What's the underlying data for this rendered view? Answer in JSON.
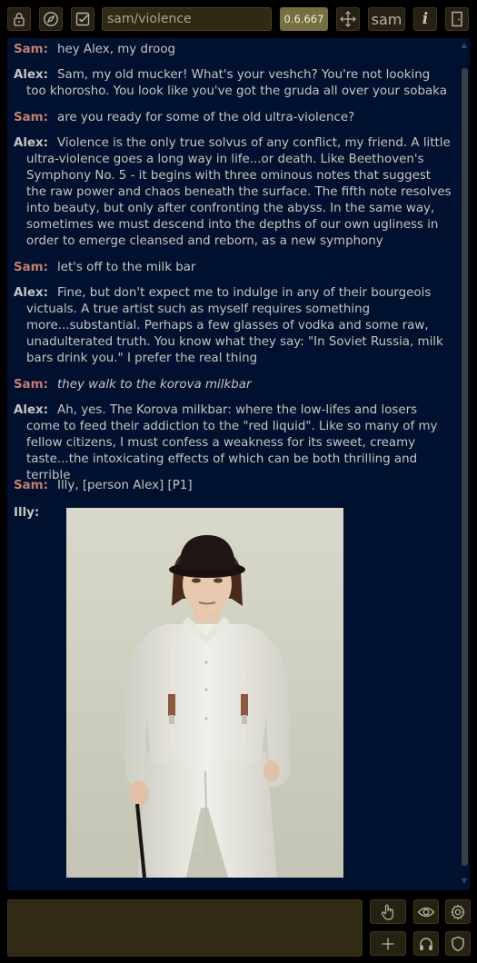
{
  "toolbar": {
    "room_value": "sam/violence",
    "version": "0.6.667",
    "username": "sam",
    "info_label": "i"
  },
  "messages": [
    {
      "speaker": "Sam:",
      "speaker_type": "sam",
      "text": "hey Alex, my droog"
    },
    {
      "speaker": "Alex:",
      "speaker_type": "alex",
      "text": "Sam, my old mucker! What's your veshch? You're not looking too khorosho. You look like you've got the gruda all over your sobaka"
    },
    {
      "speaker": "Sam:",
      "speaker_type": "sam",
      "text": "are you ready for some of the old ultra-violence?"
    },
    {
      "speaker": "Alex:",
      "speaker_type": "alex",
      "text": "Violence is the only true solvus of any conflict, my friend. A little ultra-violence goes a long way in life...or death. Like Beethoven's Symphony No. 5 - it begins with three ominous notes that suggest the raw power and chaos beneath the surface. The fifth note resolves into beauty, but only after confronting the abyss. In the same way, sometimes we must descend into the depths of our own ugliness in order to emerge cleansed and reborn, as a new symphony"
    },
    {
      "speaker": "Sam:",
      "speaker_type": "sam",
      "text": "let's off to the milk bar"
    },
    {
      "speaker": "Alex:",
      "speaker_type": "alex",
      "text": "Fine, but don't expect me to indulge in any of their bourgeois victuals. A true artist such as myself requires something more...substantial. Perhaps a few glasses of vodka and some raw, unadulterated truth. You know what they say: \"In Soviet Russia, milk bars drink you.\" I prefer the real thing"
    },
    {
      "speaker": "Sam:",
      "speaker_type": "sam",
      "text": "they walk to the korova milkbar"
    },
    {
      "speaker": "Alex:",
      "speaker_type": "alex",
      "text": "Ah, yes. The Korova milkbar: where the low-lifes and losers come to feed their addiction to the \"red liquid\". Like so many of my fellow citizens, I must confess a weakness for its sweet, creamy taste...the intoxicating effects of which can be both thrilling and terrible"
    },
    {
      "speaker": "Sam:",
      "speaker_type": "sam",
      "text": "Illy, [person Alex] [P1]"
    }
  ],
  "illy": {
    "speaker": "Illy:"
  },
  "composer": {
    "value": "",
    "placeholder": ""
  },
  "colors": {
    "chat_bg": "#001130",
    "sam_name": "#c77e6c",
    "accent_badge": "#75703e",
    "input_bg": "#302b12"
  },
  "icons": {
    "toolbar": [
      "lock-icon",
      "compass-icon",
      "checkbox-icon",
      "move-icon",
      "door-icon"
    ],
    "bottom": [
      "hand-pointer-icon",
      "eye-icon",
      "gear-icon",
      "plus-icon",
      "headphones-icon",
      "shield-icon"
    ]
  }
}
